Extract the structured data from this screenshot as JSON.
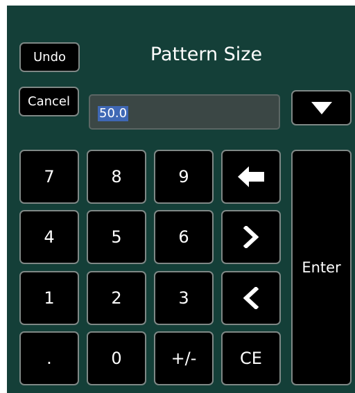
{
  "dialog": {
    "title": "Pattern Size",
    "undo_label": "Undo",
    "cancel_label": "Cancel",
    "value": "50.0",
    "dropdown_icon": "triangle-down-icon"
  },
  "keypad": {
    "keys": [
      "7",
      "8",
      "9",
      "4",
      "5",
      "6",
      "1",
      "2",
      "3",
      ".",
      "0",
      "+/-",
      "CE"
    ],
    "backspace_icon": "arrow-left-icon",
    "right_icon": "chevron-right-icon",
    "left_icon": "chevron-left-icon",
    "enter_label": "Enter"
  },
  "colors": {
    "background": "#143f38",
    "button": "#000000",
    "button_border": "#7f8886",
    "input_bg": "#3b4745",
    "selection": "#3f68b5"
  }
}
